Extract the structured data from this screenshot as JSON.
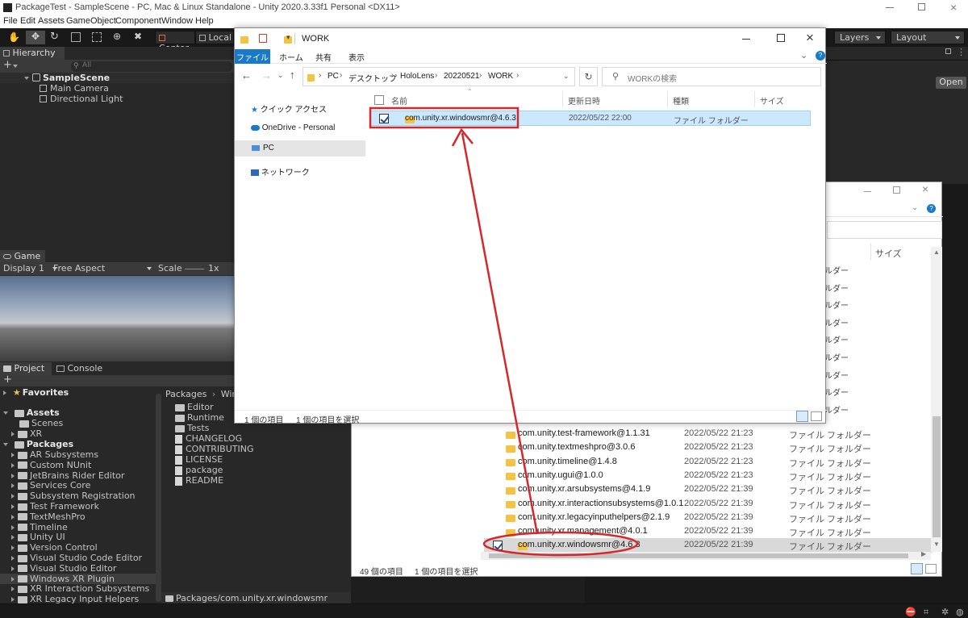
{
  "unity": {
    "title": "PackageTest - SampleScene - PC, Mac & Linux Standalone - Unity 2020.3.33f1 Personal <DX11>",
    "menu": [
      "File",
      "Edit",
      "Assets",
      "GameObject",
      "Component",
      "Window",
      "Help"
    ],
    "toolbar": {
      "center": "Center",
      "local": "Local",
      "layers": "Layers",
      "layout": "Layout"
    },
    "hierarchy": {
      "tab": "Hierarchy",
      "search_placeholder": "All",
      "scene": "SampleScene",
      "items": [
        "Main Camera",
        "Directional Light"
      ]
    },
    "inspector_open": "Open",
    "game": {
      "tab": "Game",
      "display": "Display 1",
      "aspect": "Free Aspect",
      "scale_label": "Scale",
      "scale_value": "1x"
    },
    "project": {
      "tabs": [
        "Project",
        "Console"
      ],
      "favorites": "Favorites",
      "assets": "Assets",
      "asset_children": [
        "Scenes",
        "XR"
      ],
      "packages": "Packages",
      "package_children": [
        "AR Subsystems",
        "Custom NUnit",
        "JetBrains Rider Editor",
        "Services Core",
        "Subsystem Registration",
        "Test Framework",
        "TextMeshPro",
        "Timeline",
        "Unity UI",
        "Version Control",
        "Visual Studio Code Editor",
        "Visual Studio Editor",
        "Windows XR Plugin",
        "XR Interaction Subsystems",
        "XR Legacy Input Helpers"
      ],
      "breadcrumb_root": "Packages",
      "breadcrumb_current": "Wind",
      "content_folders": [
        "Editor",
        "Runtime",
        "Tests"
      ],
      "content_files": [
        "CHANGELOG",
        "CONTRIBUTING",
        "LICENSE",
        "package",
        "README"
      ],
      "footer_path": "Packages/com.unity.xr.windowsmr"
    }
  },
  "explorer_front": {
    "title": "WORK",
    "ribbon": [
      "ファイル",
      "ホーム",
      "共有",
      "表示"
    ],
    "path": [
      "PC",
      "デスクトップ",
      "HoloLens",
      "20220521",
      "WORK"
    ],
    "search_placeholder": "WORKの検索",
    "nav": [
      "クイック アクセス",
      "OneDrive - Personal",
      "PC",
      "ネットワーク"
    ],
    "columns": [
      "名前",
      "更新日時",
      "種類",
      "サイズ"
    ],
    "row": {
      "name": "com.unity.xr.windowsmr@4.6.3",
      "date": "2022/05/22 22:00",
      "type": "ファイル フォルダー"
    },
    "status": [
      "1 個の項目",
      "1 個の項目を選択"
    ]
  },
  "explorer_back": {
    "size_col": "サイズ",
    "partial_type": "ルダー",
    "rows": [
      {
        "name": "com.unity.test-framework@1.1.31",
        "date": "2022/05/22 21:23",
        "type": "ファイル フォルダー"
      },
      {
        "name": "com.unity.textmeshpro@3.0.6",
        "date": "2022/05/22 21:23",
        "type": "ファイル フォルダー"
      },
      {
        "name": "com.unity.timeline@1.4.8",
        "date": "2022/05/22 21:23",
        "type": "ファイル フォルダー"
      },
      {
        "name": "com.unity.ugui@1.0.0",
        "date": "2022/05/22 21:23",
        "type": "ファイル フォルダー"
      },
      {
        "name": "com.unity.xr.arsubsystems@4.1.9",
        "date": "2022/05/22 21:39",
        "type": "ファイル フォルダー"
      },
      {
        "name": "com.unity.xr.interactionsubsystems@1.0.1",
        "date": "2022/05/22 21:39",
        "type": "ファイル フォルダー"
      },
      {
        "name": "com.unity.xr.legacyinputhelpers@2.1.9",
        "date": "2022/05/22 21:39",
        "type": "ファイル フォルダー"
      },
      {
        "name": "com.unity.xr.management@4.0.1",
        "date": "2022/05/22 21:39",
        "type": "ファイル フォルダー"
      },
      {
        "name": "com.unity.xr.windowsmr@4.6.3",
        "date": "2022/05/22 21:39",
        "type": "ファイル フォルダー"
      }
    ],
    "status": [
      "49 個の項目",
      "1 個の項目を選択"
    ]
  },
  "colors": {
    "highlight": "#d6272c",
    "selection": "#cce8ff",
    "ribbon_blue": "#1979ca",
    "unity_bg": "#191919"
  }
}
